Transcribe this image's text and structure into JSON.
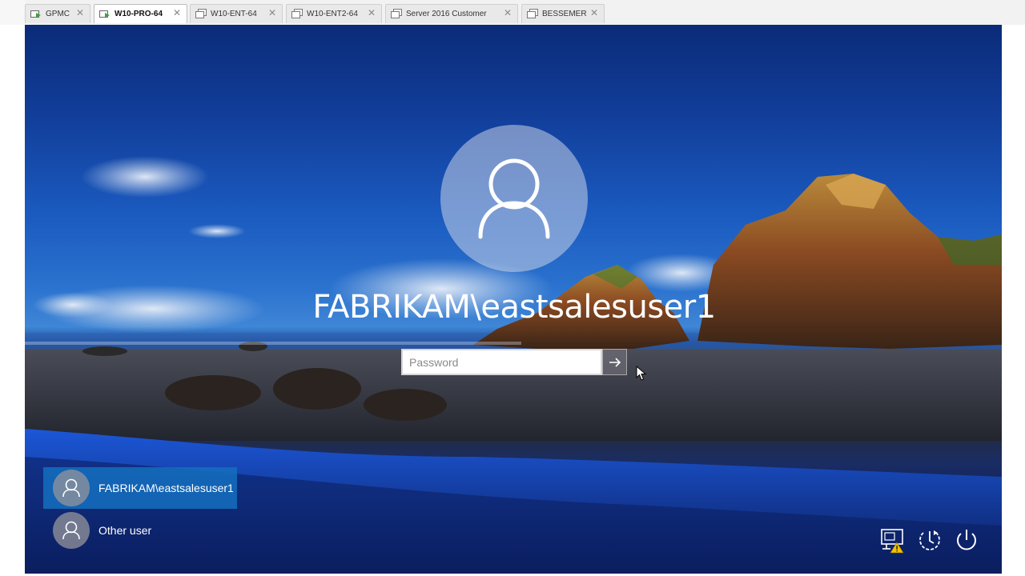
{
  "tabs": [
    {
      "label": "GPMC",
      "active": false,
      "icon": "vm-running-icon"
    },
    {
      "label": "W10-PRO-64",
      "active": true,
      "icon": "vm-running-icon"
    },
    {
      "label": "W10-ENT-64",
      "active": false,
      "icon": "vm-icon"
    },
    {
      "label": "W10-ENT2-64",
      "active": false,
      "icon": "vm-icon"
    },
    {
      "label": "Server 2016 Customer",
      "active": false,
      "icon": "vm-icon"
    },
    {
      "label": "BESSEMER",
      "active": false,
      "icon": "vm-icon"
    }
  ],
  "lock_screen": {
    "user_name": "FABRIKAM\\eastsalesuser1",
    "password_placeholder": "Password",
    "submit_icon": "arrow-right-icon"
  },
  "user_list": [
    {
      "label": "FABRIKAM\\eastsalesuser1",
      "selected": true
    },
    {
      "label": "Other user",
      "selected": false
    }
  ],
  "system_icons": [
    "network-warning-icon",
    "ease-of-access-icon",
    "power-icon"
  ],
  "colors": {
    "selected_user": "#146ebe",
    "tab_active": "#ffffff",
    "tab_inactive": "#e9e9e9"
  }
}
